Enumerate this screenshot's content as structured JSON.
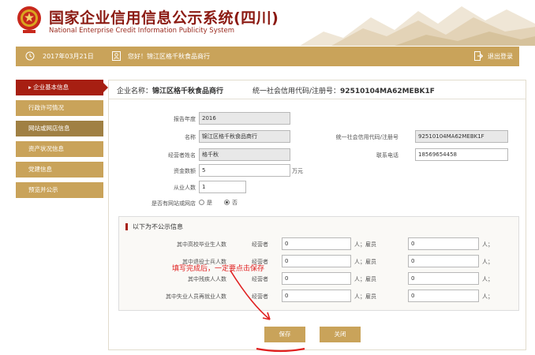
{
  "header": {
    "title_cn": "国家企业信用信息公示系统(四川)",
    "title_en": "National Enterprise Credit Information Publicity System"
  },
  "topbar": {
    "date": "2017年03月21日",
    "greeting": "您好！锦江区格千秋食品商行",
    "logout": "退出登录"
  },
  "sidebar": {
    "items": [
      {
        "label": "企业基本信息"
      },
      {
        "label": "行政许可情况"
      },
      {
        "label": "网站或网店信息"
      },
      {
        "label": "资产状况信息"
      },
      {
        "label": "党建信息"
      },
      {
        "label": "预览并公示"
      }
    ]
  },
  "main": {
    "enterprise_label": "企业名称：",
    "enterprise_name": "锦江区格千秋食品商行",
    "code_label": "统一社会信用代码/注册号：",
    "code_value": "92510104MA62MEBK1F"
  },
  "form": {
    "year_label": "报告年度",
    "year_value": "2016",
    "name_label": "名称",
    "name_value": "锦江区格千秋食品商行",
    "credit_label": "统一社会信用代码/注册号",
    "credit_value": "92510104MA62MEBK1F",
    "operator_label": "经营者姓名",
    "operator_value": "格千秋",
    "phone_label": "联系电话",
    "phone_value": "18569654458",
    "capital_label": "资金数额",
    "capital_value": "5",
    "capital_unit": "万元",
    "staff_label": "从业人数",
    "staff_value": "1",
    "website_label": "是否有网站或网店",
    "radio_yes": "是",
    "radio_no": "否"
  },
  "private": {
    "title": "以下为不公示信息",
    "operator_label": "经营者",
    "employee_label": "人；雇员",
    "person_suffix": "人；",
    "rows": [
      {
        "label": "其中高校毕业生人数",
        "operator_value": "0",
        "employee_value": "0"
      },
      {
        "label": "其中退役士兵人数",
        "operator_value": "0",
        "employee_value": "0"
      },
      {
        "label": "其中残疾人人数",
        "operator_value": "0",
        "employee_value": "0"
      },
      {
        "label": "其中失业人员再就业人数",
        "operator_value": "0",
        "employee_value": "0"
      }
    ]
  },
  "buttons": {
    "save": "保存",
    "close": "关闭"
  },
  "annotation": "填写完成后，一定要点击保存",
  "colors": {
    "brand_red": "#8b1a12",
    "gold": "#c9a35a",
    "active_red": "#a71f12",
    "annotation_red": "#e02020"
  }
}
